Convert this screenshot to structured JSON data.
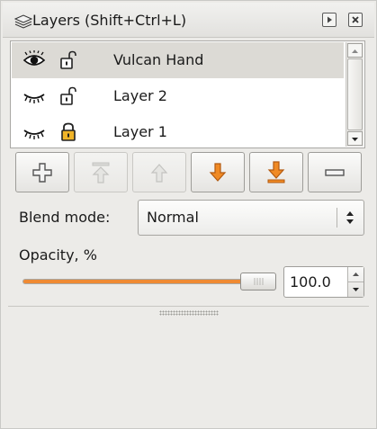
{
  "titlebar": {
    "title": "Layers (Shift+Ctrl+L)",
    "icons": [
      "layers-icon",
      "undock-icon",
      "close-icon"
    ]
  },
  "layers": [
    {
      "name": "Vulcan Hand",
      "visible": true,
      "locked": false,
      "selected": true
    },
    {
      "name": "Layer 2",
      "visible": false,
      "locked": false,
      "selected": false
    },
    {
      "name": "Layer 1",
      "visible": false,
      "locked": true,
      "selected": false
    }
  ],
  "toolbar": {
    "buttons": [
      {
        "name": "add-layer",
        "icon": "plus-icon",
        "enabled": true
      },
      {
        "name": "raise-to-top",
        "icon": "raise-top-icon",
        "enabled": false
      },
      {
        "name": "raise",
        "icon": "raise-icon",
        "enabled": false
      },
      {
        "name": "lower",
        "icon": "lower-icon",
        "enabled": true
      },
      {
        "name": "lower-to-bottom",
        "icon": "lower-bottom-icon",
        "enabled": true
      },
      {
        "name": "delete-layer",
        "icon": "minus-icon",
        "enabled": true
      }
    ]
  },
  "blend": {
    "label": "Blend mode:",
    "value": "Normal"
  },
  "opacity": {
    "label": "Opacity, %",
    "value": "100.0",
    "fraction": 1.0
  },
  "colors": {
    "accent": "#ef8a33",
    "selected_row": "#dcdad5"
  }
}
